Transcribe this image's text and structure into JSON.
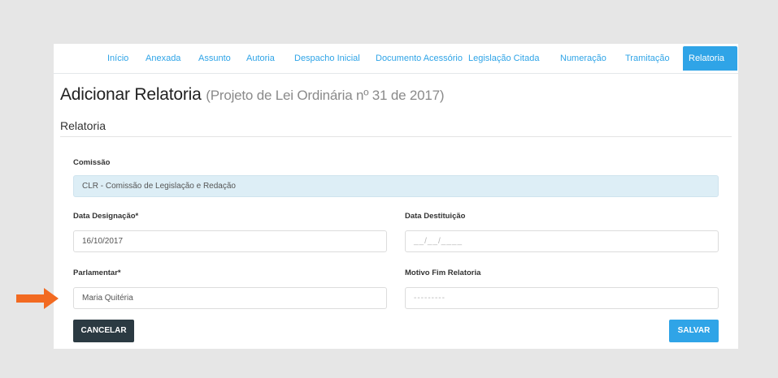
{
  "tabs": [
    {
      "label": "Início"
    },
    {
      "label": "Anexada"
    },
    {
      "label": "Assunto"
    },
    {
      "label": "Autoria"
    },
    {
      "label": "Despacho Inicial"
    },
    {
      "label": "Documento Acessório"
    },
    {
      "label": "Legislação Citada"
    },
    {
      "label": "Numeração"
    },
    {
      "label": "Tramitação"
    },
    {
      "label": "Relatoria",
      "active": true
    }
  ],
  "page": {
    "title": "Adicionar Relatoria",
    "subtitle": "(Projeto de Lei Ordinária nº 31 de 2017)"
  },
  "section": {
    "title": "Relatoria"
  },
  "form": {
    "comissao": {
      "label": "Comissão",
      "value": "CLR - Comissão de Legislação e Redação"
    },
    "data_designacao": {
      "label": "Data Designação*",
      "value": "16/10/2017"
    },
    "data_destituicao": {
      "label": "Data Destituição",
      "placeholder": "__/__/____"
    },
    "parlamentar": {
      "label": "Parlamentar*",
      "value": "Maria Quitéria"
    },
    "motivo_fim": {
      "label": "Motivo Fim Relatoria",
      "value": "---------"
    }
  },
  "buttons": {
    "cancel": "CANCELAR",
    "save": "SALVAR"
  },
  "colors": {
    "accent": "#2fa4e7",
    "arrow": "#f26a21",
    "dark_button": "#2b3a42"
  },
  "icons": {
    "pointer": "arrow-right-icon"
  }
}
